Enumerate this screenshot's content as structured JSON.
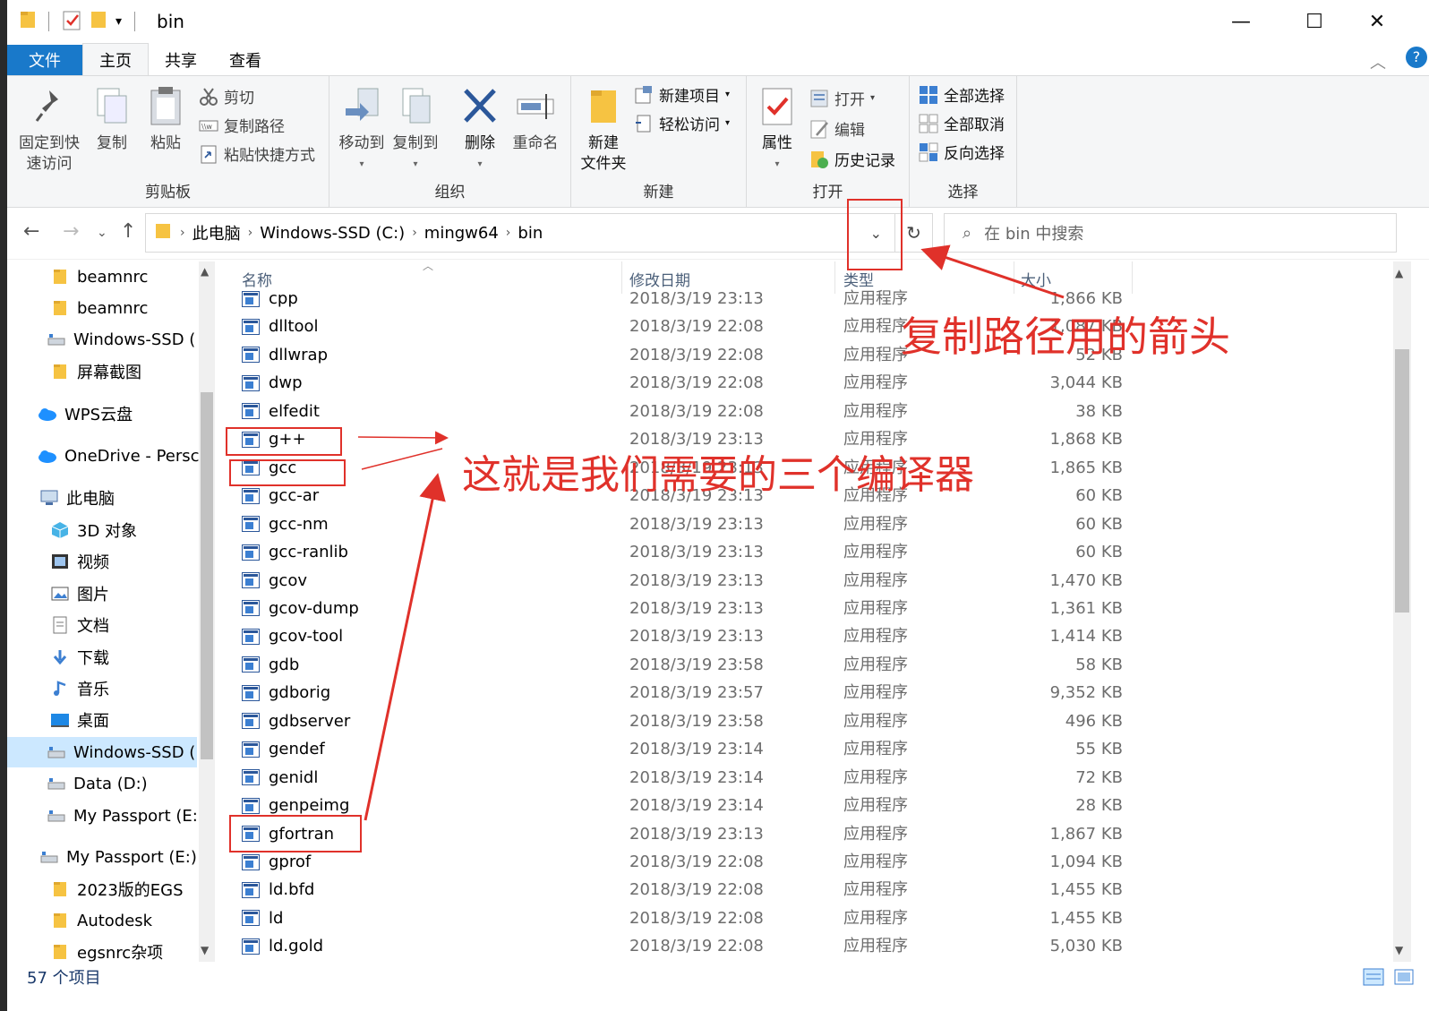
{
  "window": {
    "title": "bin"
  },
  "ribbon_tabs": [
    "文件",
    "主页",
    "共享",
    "查看"
  ],
  "ribbon": {
    "clipboard": {
      "pin_label_1": "固定到快",
      "pin_label_2": "速访问",
      "copy": "复制",
      "paste": "粘贴",
      "cut": "剪切",
      "copy_path": "复制路径",
      "paste_shortcut": "粘贴快捷方式",
      "label": "剪贴板"
    },
    "organize": {
      "move_to": "移动到",
      "copy_to": "复制到",
      "delete": "删除",
      "rename": "重命名",
      "label": "组织"
    },
    "new": {
      "new_folder_1": "新建",
      "new_folder_2": "文件夹",
      "new_item": "新建项目",
      "easy_access": "轻松访问",
      "label": "新建"
    },
    "open": {
      "properties": "属性",
      "open": "打开",
      "edit": "编辑",
      "history": "历史记录",
      "label": "打开"
    },
    "select": {
      "select_all": "全部选择",
      "select_none": "全部取消",
      "invert": "反向选择",
      "label": "选择"
    }
  },
  "address": {
    "crumbs": [
      "此电脑",
      "Windows-SSD (C:)",
      "mingw64",
      "bin"
    ],
    "search_placeholder": "在 bin 中搜索"
  },
  "nav_items": [
    {
      "label": "beamnrc",
      "icon": "folder-icon"
    },
    {
      "label": "beamnrc",
      "icon": "folder-icon"
    },
    {
      "label": "Windows-SSD (",
      "icon": "drive-icon"
    },
    {
      "label": "屏幕截图",
      "icon": "folder-icon"
    },
    {
      "label": "WPS云盘",
      "icon": "cloud-icon"
    },
    {
      "label": "OneDrive - Persc",
      "icon": "cloud-icon"
    },
    {
      "label": "此电脑",
      "icon": "computer-icon"
    },
    {
      "label": "3D 对象",
      "icon": "3d-icon"
    },
    {
      "label": "视频",
      "icon": "video-icon"
    },
    {
      "label": "图片",
      "icon": "picture-icon"
    },
    {
      "label": "文档",
      "icon": "document-icon"
    },
    {
      "label": "下载",
      "icon": "download-icon"
    },
    {
      "label": "音乐",
      "icon": "music-icon"
    },
    {
      "label": "桌面",
      "icon": "desktop-icon"
    },
    {
      "label": "Windows-SSD (",
      "icon": "drive-icon"
    },
    {
      "label": "Data (D:)",
      "icon": "drive-icon"
    },
    {
      "label": "My Passport (E:",
      "icon": "drive-icon"
    },
    {
      "label": "My Passport (E:)",
      "icon": "drive-icon"
    },
    {
      "label": "2023版的EGS",
      "icon": "folder-icon"
    },
    {
      "label": "Autodesk",
      "icon": "folder-icon"
    },
    {
      "label": "egsnrc杂项",
      "icon": "folder-icon"
    }
  ],
  "columns": {
    "name": "名称",
    "date": "修改日期",
    "type": "类型",
    "size": "大小"
  },
  "files": [
    {
      "name": "cpp",
      "date": "2018/3/19 23:13",
      "type": "应用程序",
      "size": "1,866 KB"
    },
    {
      "name": "dlltool",
      "date": "2018/3/19 22:08",
      "type": "应用程序",
      "size": "1,087 KB"
    },
    {
      "name": "dllwrap",
      "date": "2018/3/19 22:08",
      "type": "应用程序",
      "size": "52 KB"
    },
    {
      "name": "dwp",
      "date": "2018/3/19 22:08",
      "type": "应用程序",
      "size": "3,044 KB"
    },
    {
      "name": "elfedit",
      "date": "2018/3/19 22:08",
      "type": "应用程序",
      "size": "38 KB"
    },
    {
      "name": "g++",
      "date": "2018/3/19 23:13",
      "type": "应用程序",
      "size": "1,868 KB"
    },
    {
      "name": "gcc",
      "date": "2018/3/19 23:13",
      "type": "应用程序",
      "size": "1,865 KB"
    },
    {
      "name": "gcc-ar",
      "date": "2018/3/19 23:13",
      "type": "应用程序",
      "size": "60 KB"
    },
    {
      "name": "gcc-nm",
      "date": "2018/3/19 23:13",
      "type": "应用程序",
      "size": "60 KB"
    },
    {
      "name": "gcc-ranlib",
      "date": "2018/3/19 23:13",
      "type": "应用程序",
      "size": "60 KB"
    },
    {
      "name": "gcov",
      "date": "2018/3/19 23:13",
      "type": "应用程序",
      "size": "1,470 KB"
    },
    {
      "name": "gcov-dump",
      "date": "2018/3/19 23:13",
      "type": "应用程序",
      "size": "1,361 KB"
    },
    {
      "name": "gcov-tool",
      "date": "2018/3/19 23:13",
      "type": "应用程序",
      "size": "1,414 KB"
    },
    {
      "name": "gdb",
      "date": "2018/3/19 23:58",
      "type": "应用程序",
      "size": "58 KB"
    },
    {
      "name": "gdborig",
      "date": "2018/3/19 23:57",
      "type": "应用程序",
      "size": "9,352 KB"
    },
    {
      "name": "gdbserver",
      "date": "2018/3/19 23:58",
      "type": "应用程序",
      "size": "496 KB"
    },
    {
      "name": "gendef",
      "date": "2018/3/19 23:14",
      "type": "应用程序",
      "size": "55 KB"
    },
    {
      "name": "genidl",
      "date": "2018/3/19 23:14",
      "type": "应用程序",
      "size": "72 KB"
    },
    {
      "name": "genpeimg",
      "date": "2018/3/19 23:14",
      "type": "应用程序",
      "size": "28 KB"
    },
    {
      "name": "gfortran",
      "date": "2018/3/19 23:13",
      "type": "应用程序",
      "size": "1,867 KB"
    },
    {
      "name": "gprof",
      "date": "2018/3/19 22:08",
      "type": "应用程序",
      "size": "1,094 KB"
    },
    {
      "name": "ld.bfd",
      "date": "2018/3/19 22:08",
      "type": "应用程序",
      "size": "1,455 KB"
    },
    {
      "name": "ld",
      "date": "2018/3/19 22:08",
      "type": "应用程序",
      "size": "1,455 KB"
    },
    {
      "name": "ld.gold",
      "date": "2018/3/19 22:08",
      "type": "应用程序",
      "size": "5,030 KB"
    }
  ],
  "status": {
    "count": "57 个项目"
  },
  "annotations": {
    "copy_path_arrow": "复制路径用的箭头",
    "compilers": "这就是我们需要的三个编译器"
  },
  "colors": {
    "accent": "#1979ca",
    "annotation": "#e0312a",
    "selection": "#cce8ff"
  }
}
